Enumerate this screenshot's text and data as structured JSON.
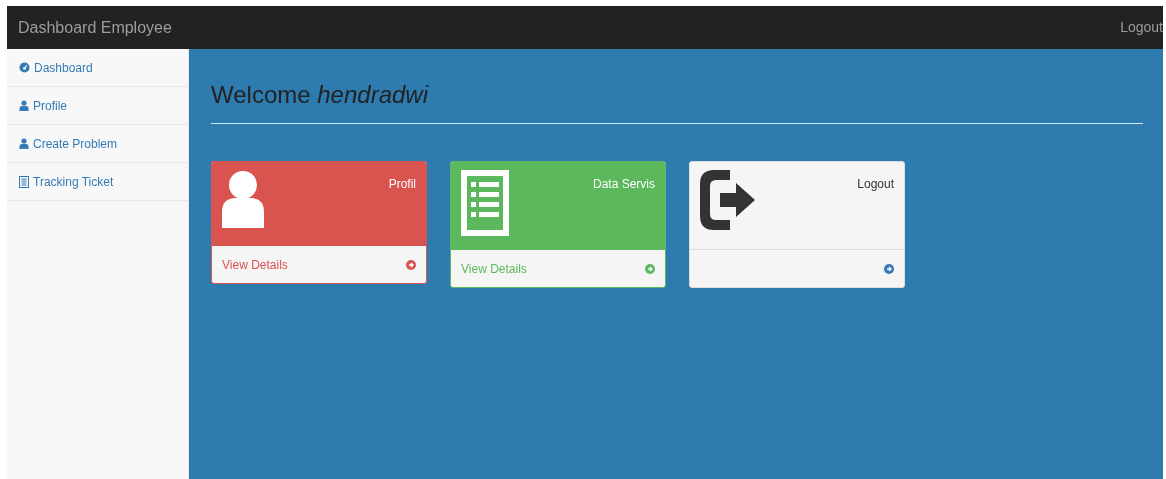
{
  "navbar": {
    "brand": "Dashboard Employee",
    "logout": "Logout"
  },
  "sidebar": {
    "items": [
      {
        "label": "Dashboard",
        "kind": "dashboard"
      },
      {
        "label": "Profile",
        "kind": "user"
      },
      {
        "label": "Create Problem",
        "kind": "user"
      },
      {
        "label": "Tracking Ticket",
        "kind": "list"
      }
    ]
  },
  "heading": "Welcome *hendradwi*",
  "panels": [
    {
      "kind": "profile",
      "title": "Profil",
      "footer": "View Details"
    },
    {
      "kind": "data",
      "title": "Data Servis",
      "footer": "View Details"
    },
    {
      "kind": "logout",
      "title": "Logout"
    }
  ]
}
